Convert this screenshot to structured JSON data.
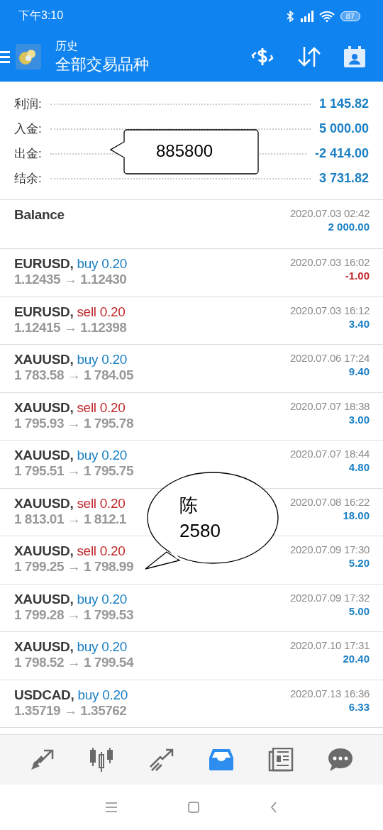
{
  "status_bar": {
    "time": "下午3:10",
    "battery": "87"
  },
  "app_bar": {
    "subtitle": "历史",
    "title": "全部交易品种"
  },
  "summary": [
    {
      "label": "利润:",
      "value": "1 145.82"
    },
    {
      "label": "入金:",
      "value": "5 000.00"
    },
    {
      "label": "出金:",
      "value": "-2 414.00"
    },
    {
      "label": "结余:",
      "value": "3 731.82"
    }
  ],
  "balance": {
    "label": "Balance",
    "time": "2020.07.03 02:42",
    "amount": "2 000.00"
  },
  "trades": [
    {
      "symbol": "EURUSD,",
      "kind": "buy",
      "volume": "buy 0.20",
      "prices": "1.12435 → 1.12430",
      "time": "2020.07.03 16:02",
      "profit": "-1.00",
      "negative": true
    },
    {
      "symbol": "EURUSD,",
      "kind": "sell",
      "volume": "sell 0.20",
      "prices": "1.12415 → 1.12398",
      "time": "2020.07.03 16:12",
      "profit": "3.40",
      "negative": false
    },
    {
      "symbol": "XAUUSD,",
      "kind": "buy",
      "volume": "buy 0.20",
      "prices": "1 783.58 → 1 784.05",
      "time": "2020.07.06 17:24",
      "profit": "9.40",
      "negative": false
    },
    {
      "symbol": "XAUUSD,",
      "kind": "sell",
      "volume": "sell 0.20",
      "prices": "1 795.93 → 1 795.78",
      "time": "2020.07.07 18:38",
      "profit": "3.00",
      "negative": false
    },
    {
      "symbol": "XAUUSD,",
      "kind": "buy",
      "volume": "buy 0.20",
      "prices": "1 795.51 → 1 795.75",
      "time": "2020.07.07 18:44",
      "profit": "4.80",
      "negative": false
    },
    {
      "symbol": "XAUUSD,",
      "kind": "sell",
      "volume": "sell 0.20",
      "prices": "1 813.01 → 1 812.1",
      "time": "2020.07.08 16:22",
      "profit": "18.00",
      "negative": false
    },
    {
      "symbol": "XAUUSD,",
      "kind": "sell",
      "volume": "sell 0.20",
      "prices": "1 799.25 → 1 798.99",
      "time": "2020.07.09 17:30",
      "profit": "5.20",
      "negative": false
    },
    {
      "symbol": "XAUUSD,",
      "kind": "buy",
      "volume": "buy 0.20",
      "prices": "1 799.28 → 1 799.53",
      "time": "2020.07.09 17:32",
      "profit": "5.00",
      "negative": false
    },
    {
      "symbol": "XAUUSD,",
      "kind": "buy",
      "volume": "buy 0.20",
      "prices": "1 798.52 → 1 799.54",
      "time": "2020.07.10 17:31",
      "profit": "20.40",
      "negative": false
    },
    {
      "symbol": "USDCAD,",
      "kind": "buy",
      "volume": "buy 0.20",
      "prices": "1.35719 → 1.35762",
      "time": "2020.07.13 16:36",
      "profit": "6.33",
      "negative": false
    }
  ],
  "bottom_nav": [
    {
      "kind": "trade",
      "selected": false
    },
    {
      "kind": "chart",
      "selected": false
    },
    {
      "kind": "trend",
      "selected": false
    },
    {
      "kind": "history",
      "selected": true
    },
    {
      "kind": "news",
      "selected": false
    },
    {
      "kind": "chat",
      "selected": false
    }
  ],
  "callouts": [
    {
      "kind": "box",
      "lines": [
        "885800"
      ]
    },
    {
      "kind": "oval",
      "lines": [
        "陈",
        "2580"
      ]
    }
  ]
}
